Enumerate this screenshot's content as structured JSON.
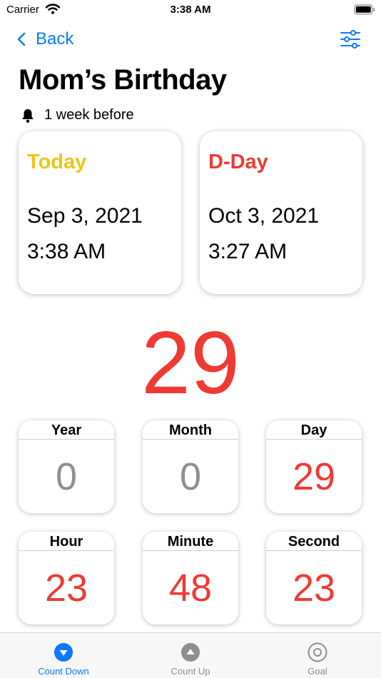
{
  "status_bar": {
    "carrier": "Carrier",
    "time": "3:38 AM"
  },
  "nav": {
    "back_label": "Back",
    "back_icon": "chevron-left-icon",
    "filter_icon": "sliders-icon"
  },
  "event": {
    "title": "Mom’s Birthday",
    "reminder": "1 week before"
  },
  "cards": {
    "today": {
      "label": "Today",
      "date": "Sep 3, 2021",
      "time": "3:38 AM"
    },
    "dday": {
      "label": "D-Day",
      "date": "Oct 3, 2021",
      "time": "3:27 AM"
    }
  },
  "countdown": "29",
  "units": [
    {
      "label": "Year",
      "value": "0"
    },
    {
      "label": "Month",
      "value": "0"
    },
    {
      "label": "Day",
      "value": "29"
    },
    {
      "label": "Hour",
      "value": "23"
    },
    {
      "label": "Minute",
      "value": "48"
    },
    {
      "label": "Second",
      "value": "23"
    }
  ],
  "tabs": [
    {
      "label": "Count Down",
      "icon": "count-down-icon",
      "active": true
    },
    {
      "label": "Count Up",
      "icon": "count-up-icon",
      "active": false
    },
    {
      "label": "Goal",
      "icon": "goal-icon",
      "active": false
    }
  ],
  "colors": {
    "accent": "#0a7aff",
    "red": "#ef3a34",
    "yellow": "#f2c416",
    "grey": "#8e8e93"
  }
}
